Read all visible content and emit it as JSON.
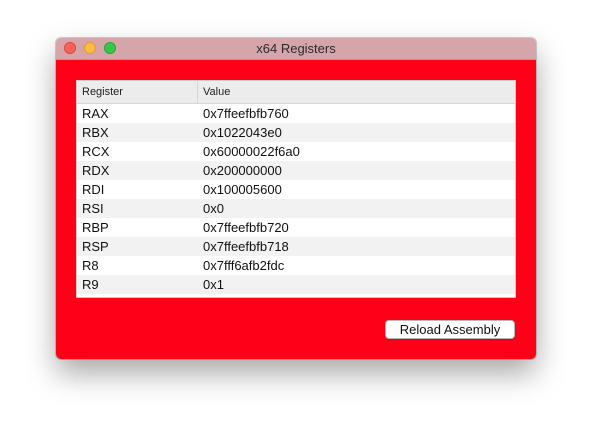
{
  "window": {
    "title": "x64 Registers"
  },
  "colors": {
    "content_background": "#ff0019",
    "titlebar": "#d5a5aa"
  },
  "table": {
    "columns": [
      "Register",
      "Value"
    ],
    "rows": [
      {
        "register": "RAX",
        "value": "0x7ffeefbfb760"
      },
      {
        "register": "RBX",
        "value": "0x1022043e0"
      },
      {
        "register": "RCX",
        "value": "0x60000022f6a0"
      },
      {
        "register": "RDX",
        "value": "0x200000000"
      },
      {
        "register": "RDI",
        "value": "0x100005600"
      },
      {
        "register": "RSI",
        "value": "0x0"
      },
      {
        "register": "RBP",
        "value": "0x7ffeefbfb720"
      },
      {
        "register": "RSP",
        "value": "0x7ffeefbfb718"
      },
      {
        "register": "R8",
        "value": "0x7fff6afb2fdc"
      },
      {
        "register": "R9",
        "value": "0x1"
      }
    ]
  },
  "actions": {
    "reload_label": "Reload Assembly"
  }
}
